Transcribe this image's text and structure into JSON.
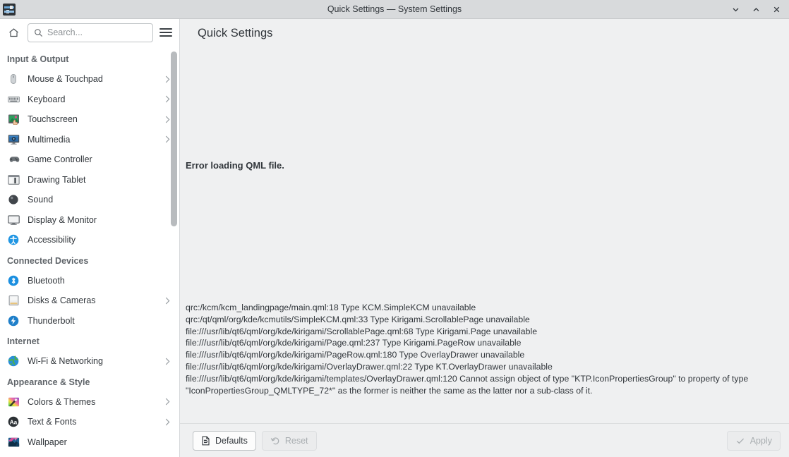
{
  "window": {
    "title": "Quick Settings — System Settings",
    "app_icon": "settings-sliders-icon",
    "controls": [
      {
        "name": "minimize",
        "glyph": "chevron-down-icon"
      },
      {
        "name": "maximize",
        "glyph": "chevron-up-icon"
      },
      {
        "name": "close",
        "glyph": "close-icon"
      }
    ]
  },
  "sidebar": {
    "home_icon": "home-icon",
    "search": {
      "icon": "search-icon",
      "placeholder": "Search...",
      "value": ""
    },
    "menu_icon": "hamburger-menu-icon",
    "groups": [
      {
        "title": "Input & Output",
        "items": [
          {
            "label": "Mouse & Touchpad",
            "icon": "mouse-icon",
            "has_chevron": true
          },
          {
            "label": "Keyboard",
            "icon": "keyboard-icon",
            "has_chevron": true
          },
          {
            "label": "Touchscreen",
            "icon": "touchscreen-icon",
            "has_chevron": true
          },
          {
            "label": "Multimedia",
            "icon": "multimedia-icon",
            "has_chevron": true
          },
          {
            "label": "Game Controller",
            "icon": "gamepad-icon",
            "has_chevron": false
          },
          {
            "label": "Drawing Tablet",
            "icon": "drawing-tablet-icon",
            "has_chevron": false
          },
          {
            "label": "Sound",
            "icon": "sound-icon",
            "has_chevron": false
          },
          {
            "label": "Display & Monitor",
            "icon": "display-icon",
            "has_chevron": false
          },
          {
            "label": "Accessibility",
            "icon": "accessibility-icon",
            "has_chevron": false
          }
        ]
      },
      {
        "title": "Connected Devices",
        "items": [
          {
            "label": "Bluetooth",
            "icon": "bluetooth-icon",
            "has_chevron": false
          },
          {
            "label": "Disks & Cameras",
            "icon": "disks-icon",
            "has_chevron": true
          },
          {
            "label": "Thunderbolt",
            "icon": "thunderbolt-icon",
            "has_chevron": false
          }
        ]
      },
      {
        "title": "Internet",
        "items": [
          {
            "label": "Wi-Fi & Networking",
            "icon": "globe-icon",
            "has_chevron": true
          }
        ]
      },
      {
        "title": "Appearance & Style",
        "items": [
          {
            "label": "Colors & Themes",
            "icon": "colors-icon",
            "has_chevron": true
          },
          {
            "label": "Text & Fonts",
            "icon": "fonts-icon",
            "has_chevron": true
          },
          {
            "label": "Wallpaper",
            "icon": "wallpaper-icon",
            "has_chevron": false
          }
        ]
      }
    ]
  },
  "content": {
    "page_title": "Quick Settings",
    "error_heading": "Error loading QML file.",
    "error_lines": [
      "qrc:/kcm/kcm_landingpage/main.qml:18 Type KCM.SimpleKCM unavailable",
      "qrc:/qt/qml/org/kde/kcmutils/SimpleKCM.qml:33 Type Kirigami.ScrollablePage unavailable",
      "file:///usr/lib/qt6/qml/org/kde/kirigami/ScrollablePage.qml:68 Type Kirigami.Page unavailable",
      "file:///usr/lib/qt6/qml/org/kde/kirigami/Page.qml:237 Type Kirigami.PageRow unavailable",
      "file:///usr/lib/qt6/qml/org/kde/kirigami/PageRow.qml:180 Type OverlayDrawer unavailable",
      "file:///usr/lib/qt6/qml/org/kde/kirigami/OverlayDrawer.qml:22 Type KT.OverlayDrawer unavailable",
      "file:///usr/lib/qt6/qml/org/kde/kirigami/templates/OverlayDrawer.qml:120 Cannot assign object of type \"KTP.IconPropertiesGroup\" to property of type \"IconPropertiesGroup_QMLTYPE_72*\" as the former is neither the same as the latter nor a sub-class of it."
    ]
  },
  "footer": {
    "defaults_label": "Defaults",
    "defaults_icon": "document-revert-icon",
    "reset_label": "Reset",
    "reset_icon": "undo-icon",
    "apply_label": "Apply",
    "apply_icon": "check-icon"
  },
  "colors": {
    "titlebar_bg": "#d8dadc",
    "sidebar_bg": "#ffffff",
    "content_bg": "#eff0f1",
    "text": "#31363b",
    "accent": "#3daee9"
  }
}
